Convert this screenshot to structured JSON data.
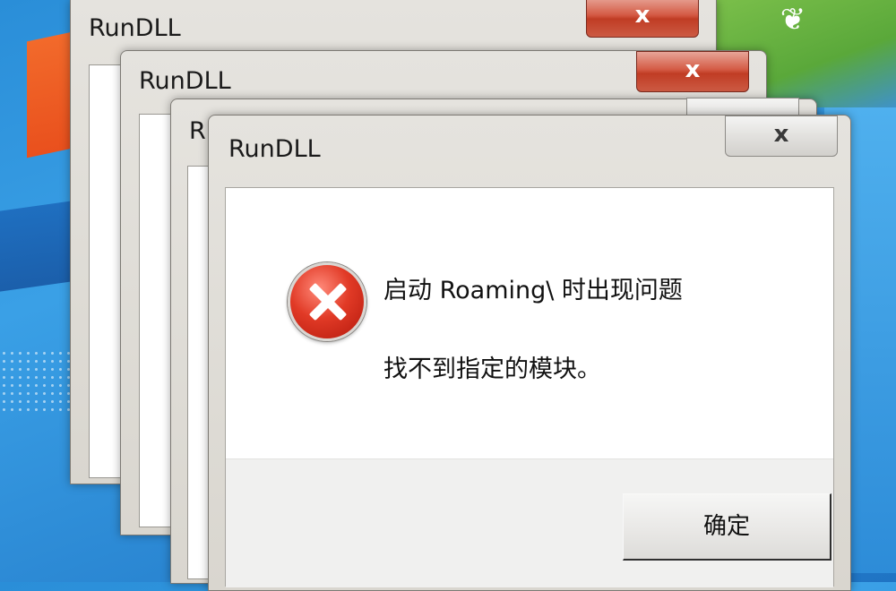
{
  "windows": [
    {
      "title": "RunDLL",
      "close_label": "x"
    },
    {
      "title": "RunDLL",
      "close_label": "x"
    },
    {
      "title": "R",
      "close_label": ""
    },
    {
      "title": "RunDLL",
      "close_label": "x"
    }
  ],
  "dialog": {
    "message_title": "启动 Roaming\\ 时出现问题",
    "message_detail": "找不到指定的模块。",
    "ok_label": "确定",
    "icon": "error-icon"
  },
  "colors": {
    "close_button": "#c03c24",
    "desktop": "#2a8ed8",
    "error_icon": "#e13a26"
  }
}
